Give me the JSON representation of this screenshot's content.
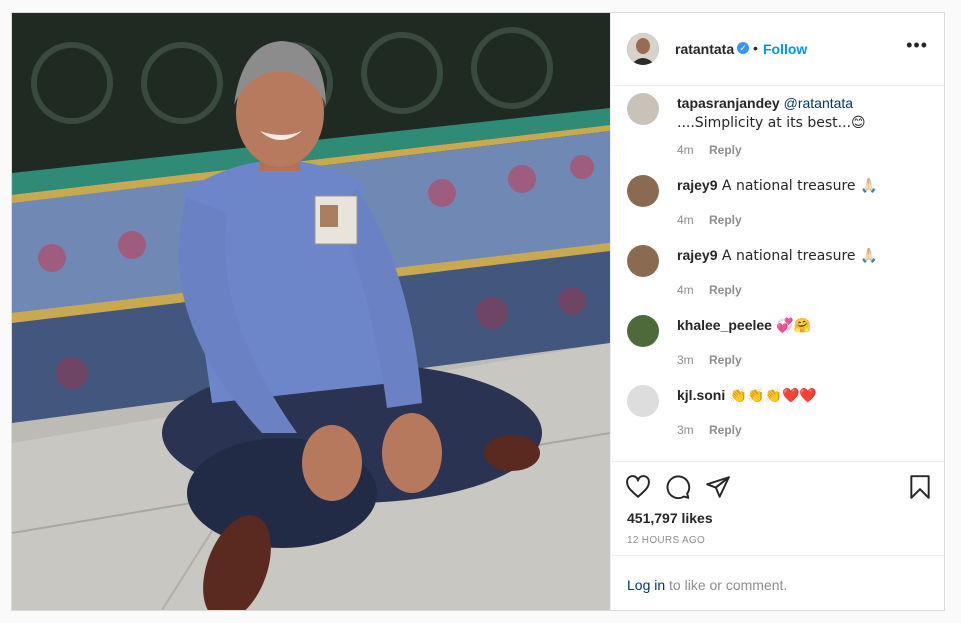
{
  "post": {
    "username": "ratantata",
    "verified_glyph": "✓",
    "separator": "•",
    "follow_label": "Follow",
    "more_label": "•••"
  },
  "comments": [
    {
      "user": "tapasranjandey",
      "mention": "@ratantata",
      "text": " ....Simplicity at its best...😊",
      "time": "4m",
      "reply": "Reply",
      "avatar_color": "#c9c2b8"
    },
    {
      "user": "rajey9",
      "mention": "",
      "text": " A national treasure 🙏🏻",
      "time": "4m",
      "reply": "Reply",
      "avatar_color": "#8a6a50"
    },
    {
      "user": "rajey9",
      "mention": "",
      "text": " A national treasure 🙏🏻",
      "time": "4m",
      "reply": "Reply",
      "avatar_color": "#8a6a50"
    },
    {
      "user": "khalee_peelee",
      "mention": "",
      "text": " 💞🤗",
      "time": "3m",
      "reply": "Reply",
      "avatar_color": "#4d6b3a"
    },
    {
      "user": "kjl.soni",
      "mention": "",
      "text": " 👏👏👏❤️❤️",
      "time": "3m",
      "reply": "Reply",
      "avatar_color": "#dddddd"
    }
  ],
  "actions": {
    "icons": [
      "heart-icon",
      "comment-icon",
      "share-icon",
      "bookmark-icon"
    ],
    "likes": "451,797 likes",
    "time_ago": "12 HOURS AGO"
  },
  "footer": {
    "login_link": "Log in",
    "login_rest": " to like or comment."
  },
  "colors": {
    "accent": "#0095f6",
    "verified": "#3897f0",
    "mention": "#00376b",
    "muted": "#8e8e8e"
  }
}
